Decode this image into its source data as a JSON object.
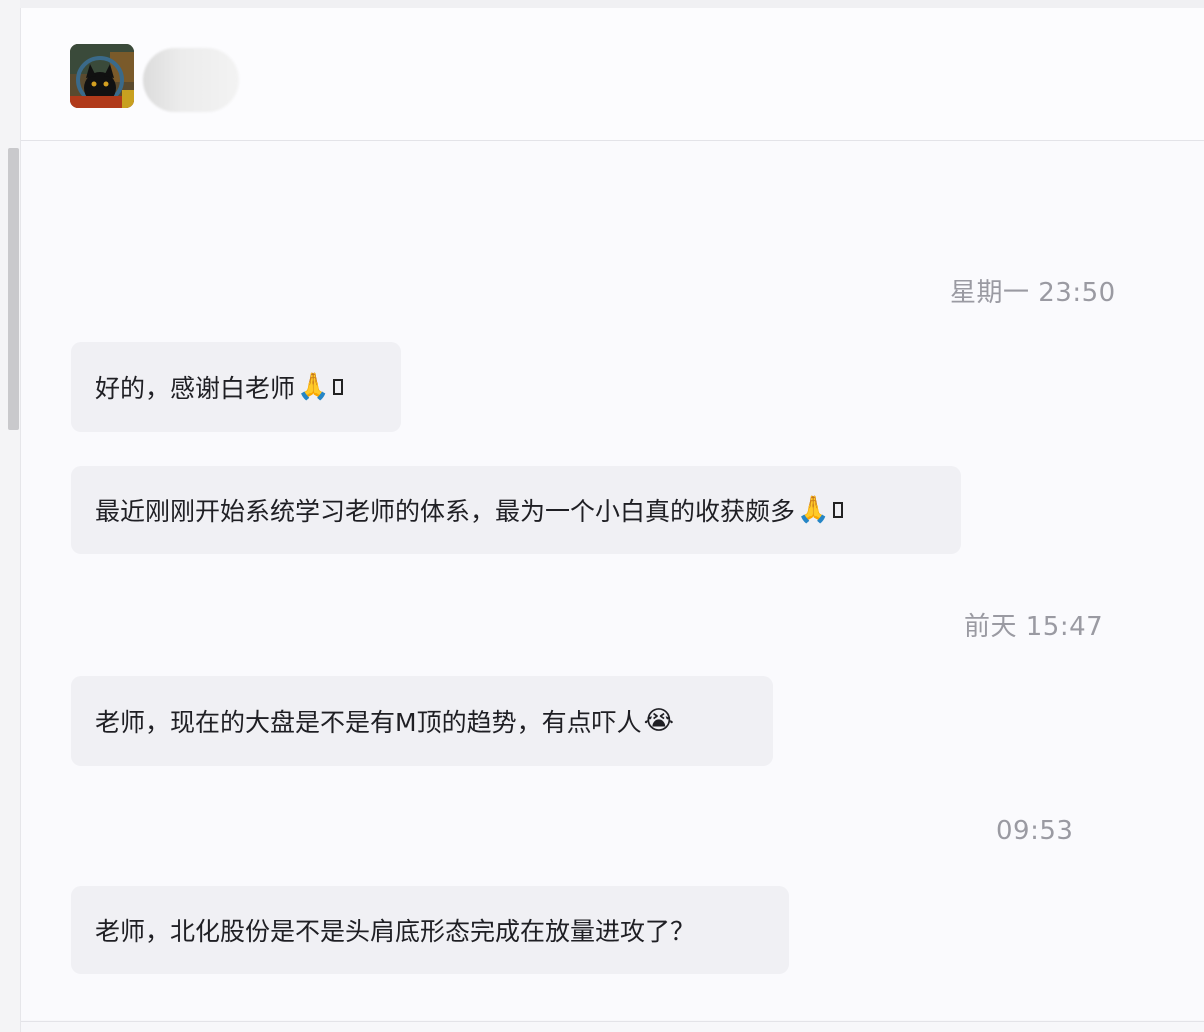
{
  "messages": [
    {
      "time": "星期一 23:50",
      "text": "好的，感谢白老师",
      "emoji": "🙏",
      "trailing_box": true
    },
    {
      "time": "",
      "text": "最近刚刚开始系统学习老师的体系，最为一个小白真的收获颇多",
      "emoji": "🙏",
      "trailing_box": true
    },
    {
      "time": "前天 15:47",
      "text": "老师，现在的大盘是不是有M顶的趋势，有点吓人",
      "emoji": "😭",
      "trailing_box": false
    },
    {
      "time": "09:53",
      "text": "老师，北化股份是不是头肩底形态完成在放量进攻了？",
      "emoji": "",
      "trailing_box": false
    }
  ]
}
